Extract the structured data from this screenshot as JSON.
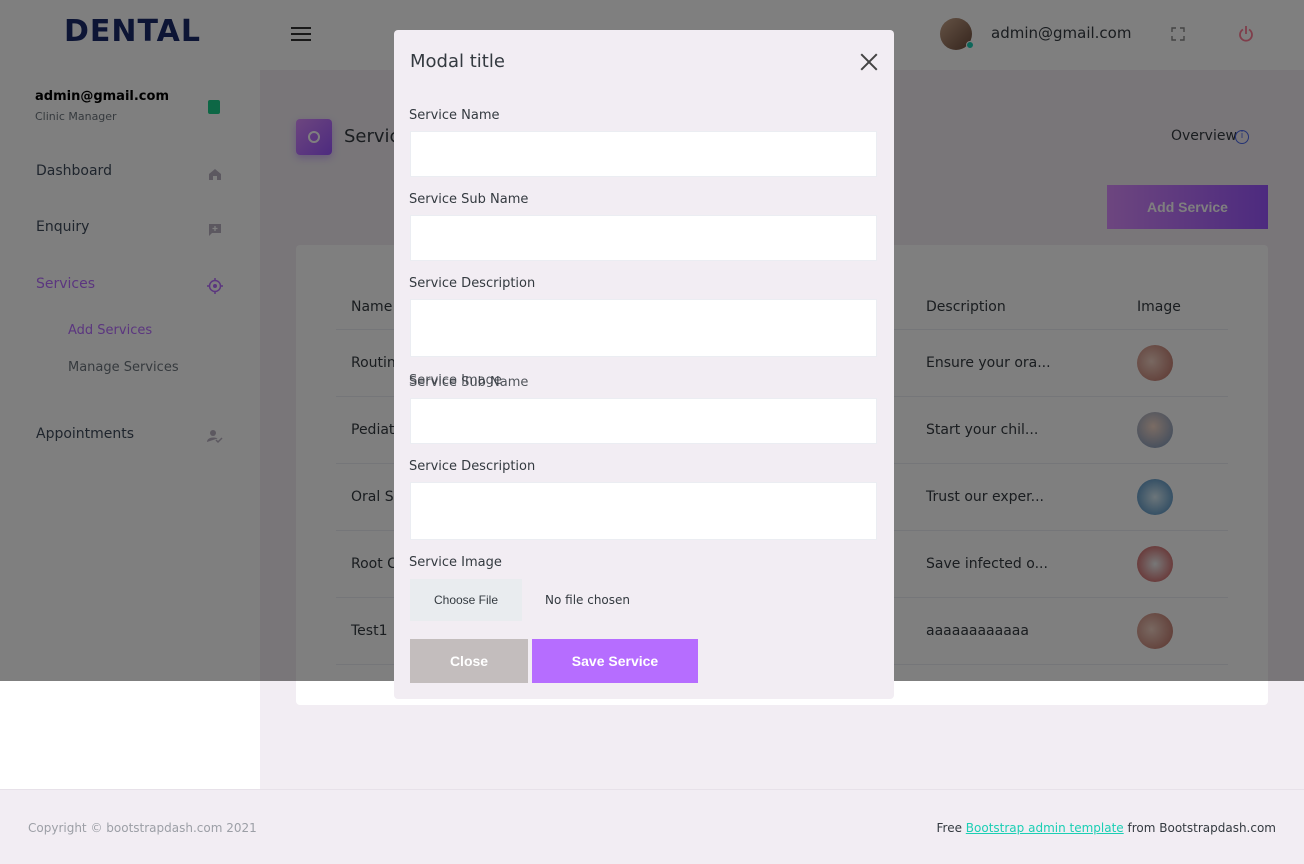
{
  "brand": "DENTAL",
  "navbar": {
    "user_email": "admin@gmail.com"
  },
  "sidebar": {
    "profile": {
      "name": "admin@gmail.com",
      "role": "Clinic Manager"
    },
    "items": [
      {
        "label": "Dashboard",
        "icon": "home-icon"
      },
      {
        "label": "Enquiry",
        "icon": "message-plus-icon"
      },
      {
        "label": "Services",
        "icon": "crosshair-icon"
      },
      {
        "label": "Appointments",
        "icon": "account-check-icon"
      }
    ],
    "sub_items": [
      "Add Services",
      "Manage Services"
    ]
  },
  "page": {
    "title": "Services",
    "overview": "Overview",
    "add_button": "Add Service"
  },
  "table": {
    "headers": [
      "Name",
      "Description",
      "Image"
    ],
    "rows": [
      {
        "name": "Routine Checkups",
        "description": "Ensure your ora..."
      },
      {
        "name": "Pediatric Dentistry",
        "description": "Start your chil..."
      },
      {
        "name": "Oral Surgery",
        "description": "Trust our exper..."
      },
      {
        "name": "Root Canal",
        "description": "Save infected o..."
      },
      {
        "name": "Test1",
        "description": "aaaaaaaaaaaa"
      }
    ]
  },
  "modal": {
    "title": "Modal title",
    "labels": {
      "service_name": "Service Name",
      "service_sub_name": "Service Sub Name",
      "service_description": "Service Description",
      "ghost_image": "Service Image",
      "ghost_subname": "Service Sub Name",
      "service_description_2": "Service Description",
      "service_image": "Service Image"
    },
    "file_button": "Choose File",
    "file_status": "No file chosen",
    "close_button": "Close",
    "save_button": "Save Service"
  },
  "footer": {
    "copyright": "Copyright © bootstrapdash.com 2021",
    "right_prefix": "Free ",
    "right_link": "Bootstrap admin template",
    "right_suffix": " from Bootstrapdash.com"
  }
}
